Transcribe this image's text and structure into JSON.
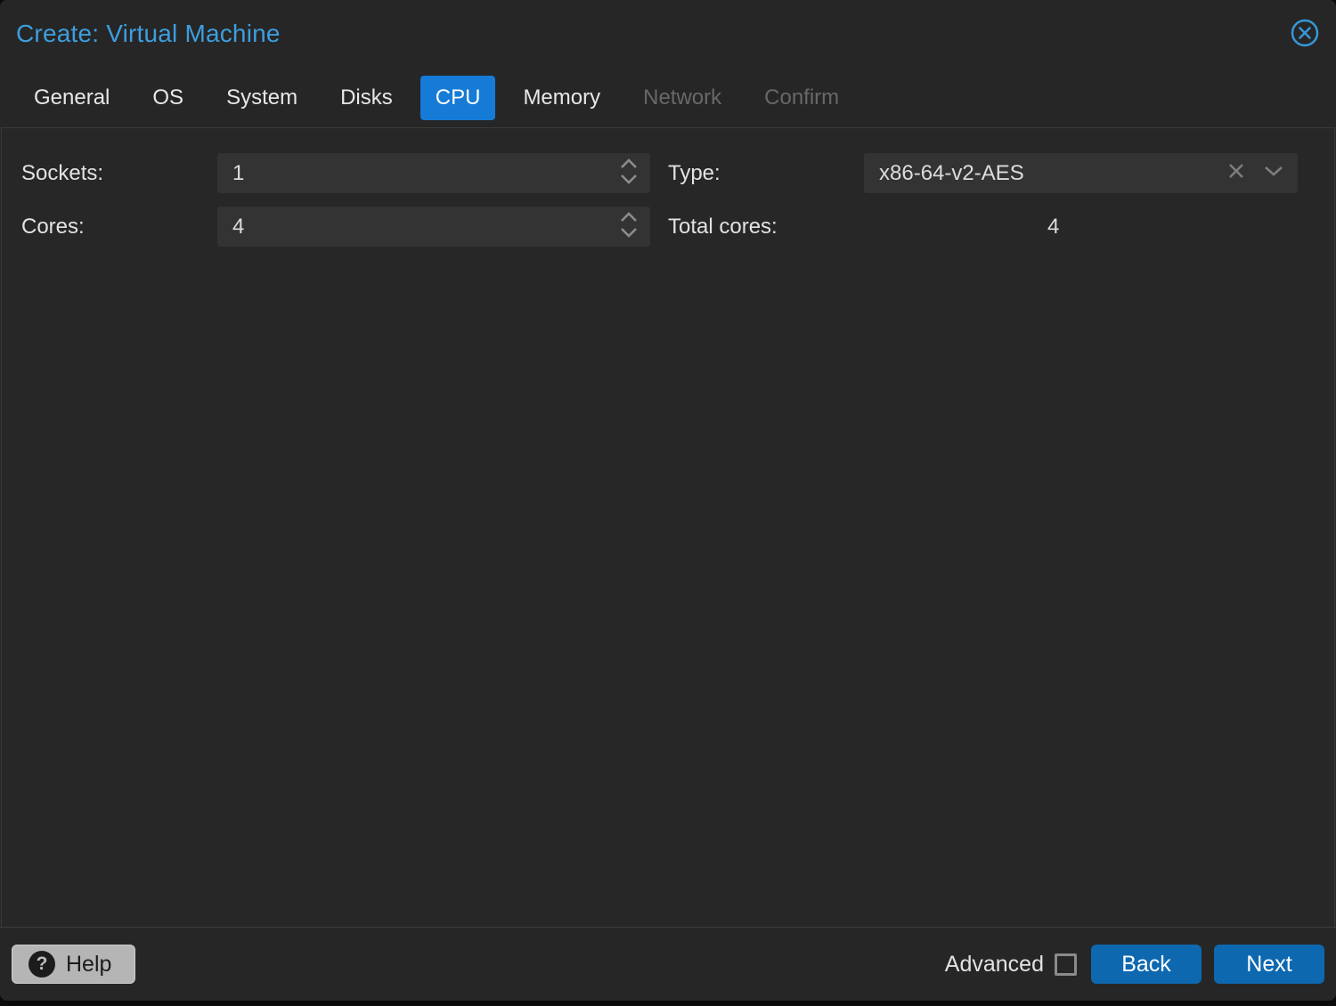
{
  "window": {
    "title": "Create: Virtual Machine"
  },
  "tabs": [
    {
      "label": "General",
      "state": "enabled"
    },
    {
      "label": "OS",
      "state": "enabled"
    },
    {
      "label": "System",
      "state": "enabled"
    },
    {
      "label": "Disks",
      "state": "enabled"
    },
    {
      "label": "CPU",
      "state": "active"
    },
    {
      "label": "Memory",
      "state": "enabled"
    },
    {
      "label": "Network",
      "state": "disabled"
    },
    {
      "label": "Confirm",
      "state": "disabled"
    }
  ],
  "form": {
    "sockets": {
      "label": "Sockets:",
      "value": "1"
    },
    "cores": {
      "label": "Cores:",
      "value": "4"
    },
    "type": {
      "label": "Type:",
      "value": "x86-64-v2-AES"
    },
    "total_cores": {
      "label": "Total cores:",
      "value": "4"
    }
  },
  "footer": {
    "help": "Help",
    "advanced": "Advanced",
    "advanced_checked": false,
    "back": "Back",
    "next": "Next"
  },
  "icons": {
    "help_glyph": "?"
  },
  "colors": {
    "title_blue": "#3d9ede",
    "active_tab_blue": "#157bd6",
    "button_blue": "#0d68b0",
    "close_icon_blue": "#3598d8"
  }
}
